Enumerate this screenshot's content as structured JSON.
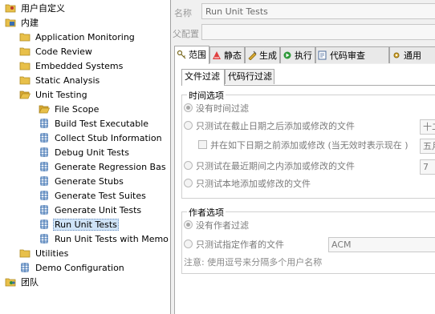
{
  "tree": {
    "items": [
      {
        "label": "用户自定义",
        "icon": "user-folder-icon",
        "level": 0
      },
      {
        "label": "内建",
        "icon": "builtin-folder-icon",
        "level": 0
      },
      {
        "label": "Application Monitoring",
        "icon": "folder-icon",
        "level": 1
      },
      {
        "label": "Code Review",
        "icon": "folder-icon",
        "level": 1
      },
      {
        "label": "Embedded Systems",
        "icon": "folder-icon",
        "level": 1
      },
      {
        "label": "Static Analysis",
        "icon": "folder-icon",
        "level": 1
      },
      {
        "label": "Unit Testing",
        "icon": "folder-open-icon",
        "level": 1
      },
      {
        "label": "File Scope",
        "icon": "folder-open-icon",
        "level": 2
      },
      {
        "label": "Build Test Executable",
        "icon": "config-icon",
        "level": 2
      },
      {
        "label": "Collect Stub Information",
        "icon": "config-icon",
        "level": 2
      },
      {
        "label": "Debug Unit Tests",
        "icon": "config-icon",
        "level": 2
      },
      {
        "label": "Generate Regression Bas",
        "icon": "config-icon",
        "level": 2
      },
      {
        "label": "Generate Stubs",
        "icon": "config-icon",
        "level": 2
      },
      {
        "label": "Generate Test Suites",
        "icon": "config-icon",
        "level": 2
      },
      {
        "label": "Generate Unit Tests",
        "icon": "config-icon",
        "level": 2
      },
      {
        "label": "Run Unit Tests",
        "icon": "config-icon",
        "level": 2,
        "selected": true
      },
      {
        "label": "Run Unit Tests with Memo",
        "icon": "config-icon",
        "level": 2
      },
      {
        "label": "Utilities",
        "icon": "folder-icon",
        "level": 1
      },
      {
        "label": "Demo Configuration",
        "icon": "config-icon",
        "level": 1
      },
      {
        "label": "团队",
        "icon": "team-folder-icon",
        "level": 0
      }
    ]
  },
  "form": {
    "name_label": "名称",
    "name_value": "Run Unit Tests",
    "parent_label": "父配置",
    "parent_value": ""
  },
  "tabs": [
    {
      "label": "范围",
      "icon": "key-icon",
      "active": true
    },
    {
      "label": "静态",
      "icon": "static-icon"
    },
    {
      "label": "生成",
      "icon": "generate-icon"
    },
    {
      "label": "执行",
      "icon": "execute-icon"
    },
    {
      "label": "代码审查",
      "icon": "code-review-icon"
    },
    {
      "label": "通用",
      "icon": "common-icon"
    }
  ],
  "subtabs": [
    {
      "label": "文件过滤",
      "active": true
    },
    {
      "label": "代码行过滤"
    }
  ],
  "time_options": {
    "title": "时间选项",
    "no_filter": "没有时间过滤",
    "after_date": "只测试在截止日期之后添加或修改的文件",
    "after_date_value": "十二",
    "before_date": "并在如下日期之前添加或修改 (当无效时表示现在 )",
    "before_date_value": "五月",
    "recent_days": "只测试在最近期间之内添加或修改的文件",
    "recent_days_value": "7",
    "local_only": "只测试本地添加或修改的文件"
  },
  "author_options": {
    "title": "作者选项",
    "no_filter": "没有作者过滤",
    "specific_author": "只测试指定作者的文件",
    "author_value": "ACM",
    "note": "注意: 使用逗号来分隔多个用户名称"
  },
  "colors": {
    "selection": "#cfe3f7",
    "folder": "#e8c04a",
    "config_icon": "#3a6fb0"
  }
}
